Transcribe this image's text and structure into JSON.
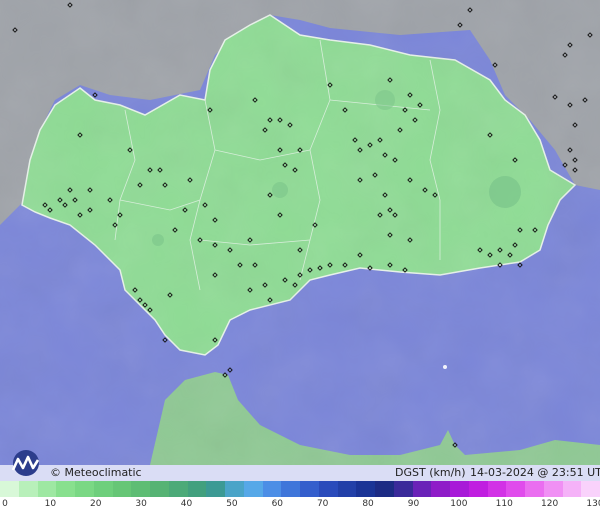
{
  "map": {
    "colors": {
      "sea": "#7b86d9",
      "land": "#9fa3a9",
      "andalusia": "#8fdc95",
      "morocco": "#8fc994",
      "border": "#e8f3ea",
      "station": "#111111"
    }
  },
  "info": {
    "copyright": "© Meteoclimatic",
    "variable": "DGST (km/h)",
    "timestamp": "14-03-2024 @ 23:51 UTC",
    "logo_icon": "meteoclimatic-logo-icon"
  },
  "scale": {
    "colors": [
      "#d8f8d8",
      "#b8f0ba",
      "#9ee8a2",
      "#88e08e",
      "#7ad884",
      "#6ecf7c",
      "#66c676",
      "#5ebd74",
      "#56b374",
      "#4caa78",
      "#42a07e",
      "#3c9a94",
      "#4aa4c8",
      "#56a8e8",
      "#4c8ee6",
      "#3f76da",
      "#345ecc",
      "#2a4bbb",
      "#2240a8",
      "#1a3496",
      "#1c2b84",
      "#3a2a9a",
      "#6a22b8",
      "#8f1cc8",
      "#a81ad8",
      "#c01ee0",
      "#d232e6",
      "#e04cec",
      "#ea6ef0",
      "#f090f4",
      "#f5b2f8",
      "#f9d2fb"
    ],
    "labels": [
      "0",
      "10",
      "20",
      "30",
      "40",
      "50",
      "60",
      "70",
      "80",
      "90",
      "100",
      "110",
      "120",
      "130"
    ]
  }
}
